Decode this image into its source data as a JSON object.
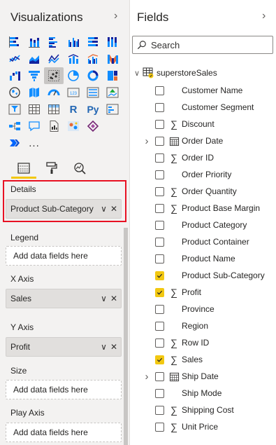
{
  "visualizations": {
    "title": "Visualizations",
    "collapse_icon": "chevron-right-icon",
    "icons": [
      [
        "stacked-bar-chart",
        "stacked-column-chart",
        "clustered-bar-chart",
        "clustered-column-chart",
        "100-stacked-bar-chart",
        "100-stacked-column-chart"
      ],
      [
        "line-chart",
        "area-chart",
        "stacked-area-chart",
        "line-and-stacked-column-chart",
        "line-and-clustered-column-chart",
        "ribbon-chart"
      ],
      [
        "waterfall-chart",
        "funnel-chart",
        "scatter-chart",
        "pie-chart",
        "donut-chart",
        "treemap"
      ],
      [
        "map",
        "filled-map",
        "gauge",
        "card",
        "multi-row-card",
        "kpi"
      ],
      [
        "slicer",
        "table",
        "matrix",
        "r-script-visual",
        "python-visual",
        "key-influencers"
      ],
      [
        "decomposition-tree",
        "qa-visual",
        "paginated-report",
        "arcgis-map",
        "power-apps",
        ""
      ],
      [
        "power-automate",
        "more-visuals"
      ]
    ],
    "selected_icon": "scatter-chart",
    "r_label": "R",
    "py_label": "Py",
    "card_label": "123",
    "more_label": "...",
    "tabs": [
      "fields-tab",
      "format-tab",
      "analytics-tab"
    ],
    "wells": {
      "details": {
        "label": "Details",
        "value": "Product Sub-Category"
      },
      "legend": {
        "label": "Legend",
        "placeholder": "Add data fields here"
      },
      "x_axis": {
        "label": "X Axis",
        "value": "Sales"
      },
      "y_axis": {
        "label": "Y Axis",
        "value": "Profit"
      },
      "size": {
        "label": "Size",
        "placeholder": "Add data fields here"
      },
      "play_axis": {
        "label": "Play Axis",
        "placeholder": "Add data fields here"
      }
    },
    "chip_dropdown_glyph": "∨",
    "chip_remove_glyph": "✕"
  },
  "fields": {
    "title": "Fields",
    "collapse_icon": "chevron-right-icon",
    "search_placeholder": "Search",
    "table_name": "superstoreSales",
    "sigma": "∑",
    "items": [
      {
        "name": "Customer Name",
        "checked": false,
        "type": "text",
        "expandable": false
      },
      {
        "name": "Customer Segment",
        "checked": false,
        "type": "text",
        "expandable": false
      },
      {
        "name": "Discount",
        "checked": false,
        "type": "sum",
        "expandable": false
      },
      {
        "name": "Order Date",
        "checked": false,
        "type": "date",
        "expandable": true
      },
      {
        "name": "Order ID",
        "checked": false,
        "type": "sum",
        "expandable": false
      },
      {
        "name": "Order Priority",
        "checked": false,
        "type": "text",
        "expandable": false
      },
      {
        "name": "Order Quantity",
        "checked": false,
        "type": "sum",
        "expandable": false
      },
      {
        "name": "Product Base Margin",
        "checked": false,
        "type": "sum",
        "expandable": false
      },
      {
        "name": "Product Category",
        "checked": false,
        "type": "text",
        "expandable": false
      },
      {
        "name": "Product Container",
        "checked": false,
        "type": "text",
        "expandable": false
      },
      {
        "name": "Product Name",
        "checked": false,
        "type": "text",
        "expandable": false
      },
      {
        "name": "Product Sub-Category",
        "checked": true,
        "type": "text",
        "expandable": false
      },
      {
        "name": "Profit",
        "checked": true,
        "type": "sum",
        "expandable": false
      },
      {
        "name": "Province",
        "checked": false,
        "type": "text",
        "expandable": false
      },
      {
        "name": "Region",
        "checked": false,
        "type": "text",
        "expandable": false
      },
      {
        "name": "Row ID",
        "checked": false,
        "type": "sum",
        "expandable": false
      },
      {
        "name": "Sales",
        "checked": true,
        "type": "sum",
        "expandable": false
      },
      {
        "name": "Ship Date",
        "checked": false,
        "type": "date",
        "expandable": true
      },
      {
        "name": "Ship Mode",
        "checked": false,
        "type": "text",
        "expandable": false
      },
      {
        "name": "Shipping Cost",
        "checked": false,
        "type": "sum",
        "expandable": false
      },
      {
        "name": "Unit Price",
        "checked": false,
        "type": "sum",
        "expandable": false
      }
    ]
  },
  "colors": {
    "accent_yellow": "#f2c811",
    "highlight_red": "#e81123",
    "pane_bg": "#f3f2f1",
    "chip_bg": "#e1dfdd"
  }
}
